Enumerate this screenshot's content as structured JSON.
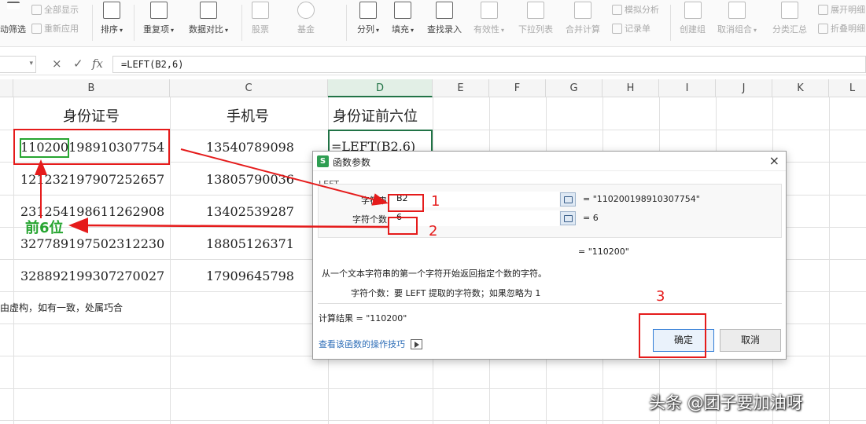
{
  "ribbon": {
    "filter_clear": "全部显示",
    "filter_reapply": "重新应用",
    "filter_adv": "动筛选",
    "sort": "排序",
    "duplicates": "重复项",
    "compare": "数据对比",
    "stocks": "股票",
    "funds": "基金",
    "split": "分列",
    "fill": "填充",
    "find_input": "查找录入",
    "validity": "有效性",
    "dropdown_list": "下拉列表",
    "consolidate": "合并计算",
    "what_if": "模拟分析",
    "record_sheet": "记录单",
    "group": "创建组",
    "ungroup": "取消组合",
    "subtotal": "分类汇总",
    "expand_detail": "展开明细",
    "collapse_detail": "折叠明细"
  },
  "formula_bar": {
    "cancel": "×",
    "confirm": "✓",
    "fx": "fx",
    "formula": "=LEFT(B2,6)"
  },
  "columns": [
    "B",
    "C",
    "D",
    "E",
    "F",
    "G",
    "H",
    "I",
    "J",
    "K",
    "L"
  ],
  "sheet": {
    "header_b": "身份证号",
    "header_c": "手机号",
    "header_d": "身份证前六位",
    "active_cell_text": "=LEFT(B2,6)",
    "id_numbers": [
      "110200198910307754",
      "121232197907252657",
      "231254198611262908",
      "327789197502312230",
      "328892199307270027"
    ],
    "phones": [
      "13540789098",
      "13805790036",
      "13402539287",
      "18805126371",
      "17909645798"
    ],
    "note": "由虚构，如有一致，处属巧合"
  },
  "dialog": {
    "title": "函数参数",
    "logo": "S",
    "close": "×",
    "function_name": "LEFT",
    "arg1_label": "字符串",
    "arg1_value": "B2",
    "arg1_result": "= \"110200198910307754\"",
    "arg2_label": "字符个数",
    "arg2_value": "6",
    "arg2_result": "= 6",
    "formula_result": "= \"110200\"",
    "description": "从一个文本字符串的第一个字符开始返回指定个数的字符。",
    "arg_description": "字符个数：要 LEFT 提取的字符数；如果忽略为 1",
    "calc_result": "计算结果 = \"110200\"",
    "help_link": "查看该函数的操作技巧",
    "ok": "确定",
    "cancel": "取消"
  },
  "annotations": {
    "step1": "1",
    "step2": "2",
    "step3": "3",
    "first6": "前6位"
  },
  "watermark": "头条 @团子要加油呀"
}
